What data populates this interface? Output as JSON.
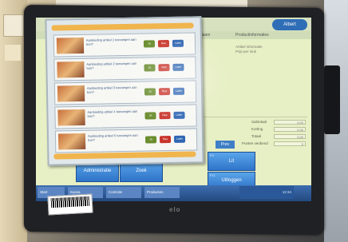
{
  "screen": {
    "logo_text": "Albert",
    "header": {
      "col_left": "Naam",
      "col_right": "Productinformaties"
    },
    "product_info": [
      "Artikel informatie",
      "Prijs per stuk"
    ],
    "fields": [
      {
        "label": "Subtotaal",
        "value": "0,00"
      },
      {
        "label": "Korting",
        "value": "0,00"
      },
      {
        "label": "Totaal",
        "value": "0,00"
      },
      {
        "label": "Punten verdiend",
        "value": "0"
      }
    ],
    "field_tab_label": "Prev",
    "buttons": {
      "admin": {
        "fn": "F10",
        "label": "Administratie"
      },
      "zoek": {
        "fn": "F3",
        "label": "Zoek"
      },
      "lit": {
        "fn": "F8",
        "label": "Lit"
      },
      "uitloggen": {
        "fn": "F11",
        "label": "Uitloggen"
      }
    },
    "taskbar": [
      "Start",
      "Kassa",
      "Controle",
      "Producten"
    ],
    "tray_text": "12:34"
  },
  "popup": {
    "rows": [
      {
        "text": "Aanbieding artikel 1 toevoegen aan bon?",
        "yes": "Ja",
        "no": "Nee",
        "later": "Later"
      },
      {
        "text": "Aanbieding artikel 2 toevoegen aan bon?",
        "yes": "Ja",
        "no": "Nee",
        "later": "Later"
      },
      {
        "text": "Aanbieding artikel 3 toevoegen aan bon?",
        "yes": "Ja",
        "no": "Nee",
        "later": "Later"
      },
      {
        "text": "Aanbieding artikel 4 toevoegen aan bon?",
        "yes": "Ja",
        "no": "Nee",
        "later": "Later"
      },
      {
        "text": "Aanbieding artikel 5 toevoegen aan bon?",
        "yes": "Ja",
        "no": "Nee",
        "later": "Later"
      }
    ]
  },
  "device": {
    "brand": "elo"
  },
  "colors": {
    "accent": "#f0b54d",
    "button_blue": "#2f74c9",
    "yes_green": "#6a8d2e",
    "no_red": "#c8342b"
  }
}
